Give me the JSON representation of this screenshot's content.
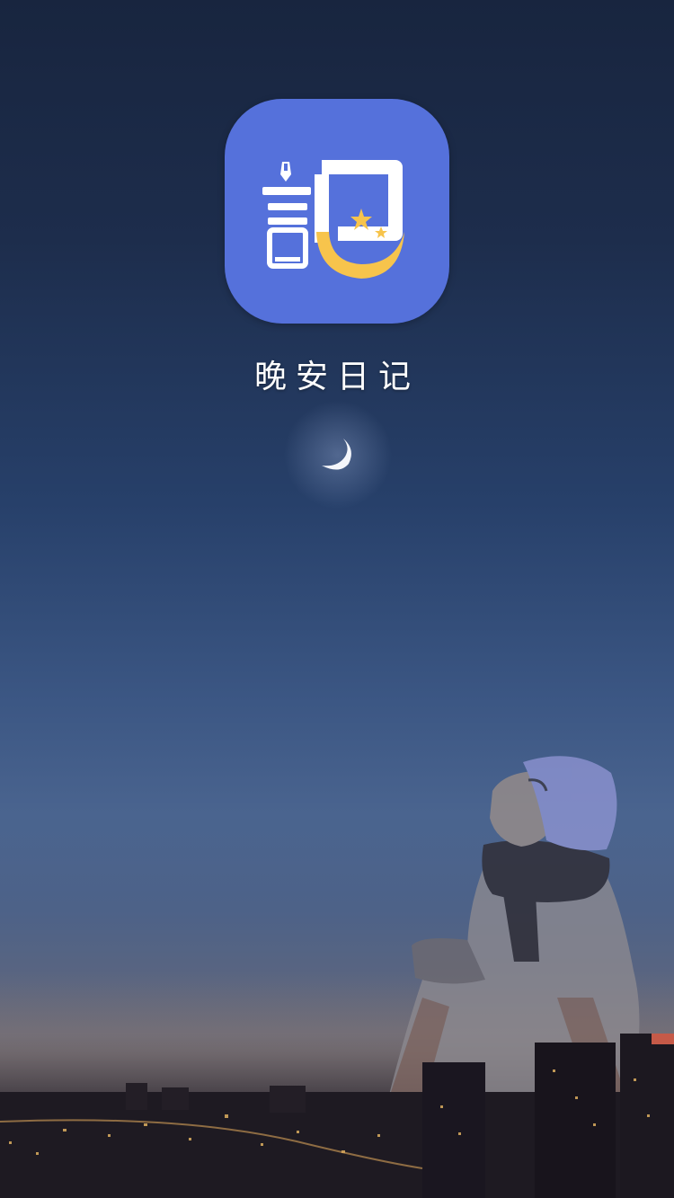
{
  "splash": {
    "app_name": "晚安日记",
    "icon": "diary-moon-logo-icon",
    "decoration": "crescent-moon-icon"
  },
  "colors": {
    "icon_background": "#5571db",
    "moon_yellow": "#f7c44c",
    "sky_top": "#18253f",
    "sky_mid": "#3b5683",
    "horizon": "#6d6a72"
  }
}
